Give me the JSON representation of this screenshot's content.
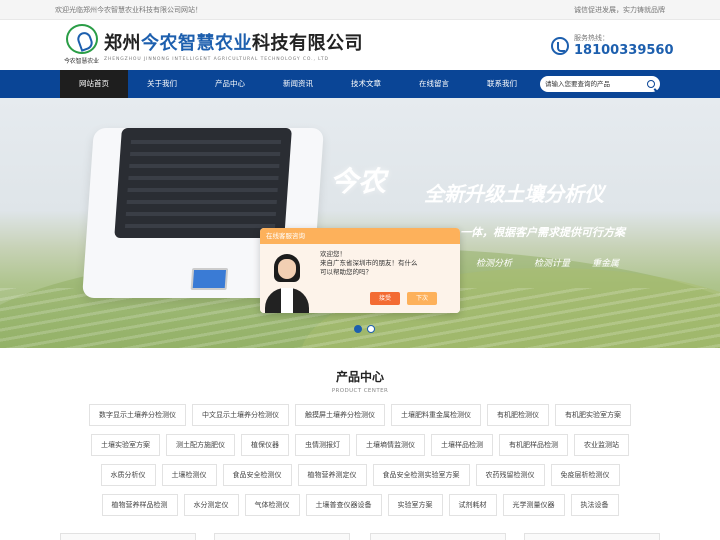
{
  "topbar": {
    "welcome": "欢迎光临郑州今农智慧农业科技有限公司网站！",
    "slogan": "诚信促进发展，实力铸就品牌"
  },
  "header": {
    "logo_text": "今农智慧农业",
    "company_prefix": "郑州",
    "company_highlight": "今农智慧农业",
    "company_suffix": "科技有限公司",
    "company_en": "ZHENGZHOU JINNONG INTELLIGENT AGRICULTURAL TECHNOLOGY CO., LTD",
    "hotline_label": "服务热线：",
    "hotline_number": "18100339560"
  },
  "nav": {
    "items": [
      {
        "label": "网站首页"
      },
      {
        "label": "关于我们"
      },
      {
        "label": "产品中心"
      },
      {
        "label": "新闻资讯"
      },
      {
        "label": "技术文章"
      },
      {
        "label": "在线留言"
      },
      {
        "label": "联系我们"
      }
    ],
    "search_placeholder": "请输入您要查询的产品"
  },
  "banner": {
    "brand": "今农",
    "headline": "全新升级土壤分析仪",
    "subline": "一体，根据客户需求提供可行方案",
    "features": [
      "检测分析",
      "检测计量",
      "重金属"
    ]
  },
  "chat": {
    "header": "在线客服咨询",
    "greeting": "欢迎您！",
    "message_1": "来自广东省深圳市的朋友！有什么",
    "message_2": "可以帮助您的吗？",
    "accept_label": "接受",
    "later_label": "下次"
  },
  "products": {
    "title": "产品中心",
    "subtitle": "PRODUCT CENTER",
    "rows": [
      [
        "数字显示土壤养分检测仪",
        "中文显示土壤养分检测仪",
        "触摸屏土壤养分检测仪",
        "土壤肥料重金属检测仪",
        "有机肥检测仪",
        "有机肥实验室方案"
      ],
      [
        "土壤实验室方案",
        "测土配方施肥仪",
        "植保仪器",
        "虫情测报灯",
        "土壤墒情监测仪",
        "土壤样品检测",
        "有机肥样品检测",
        "农业监测站"
      ],
      [
        "水质分析仪",
        "土壤检测仪",
        "食品安全检测仪",
        "植物营养测定仪",
        "食品安全检测实验室方案",
        "农药残留检测仪",
        "免疫层析检测仪"
      ],
      [
        "植物营养样品检测",
        "水分测定仪",
        "气体检测仪",
        "土壤普查仪器设备",
        "实验室方案",
        "试剂耗材",
        "光学测量仪器",
        "执法设备"
      ]
    ]
  }
}
